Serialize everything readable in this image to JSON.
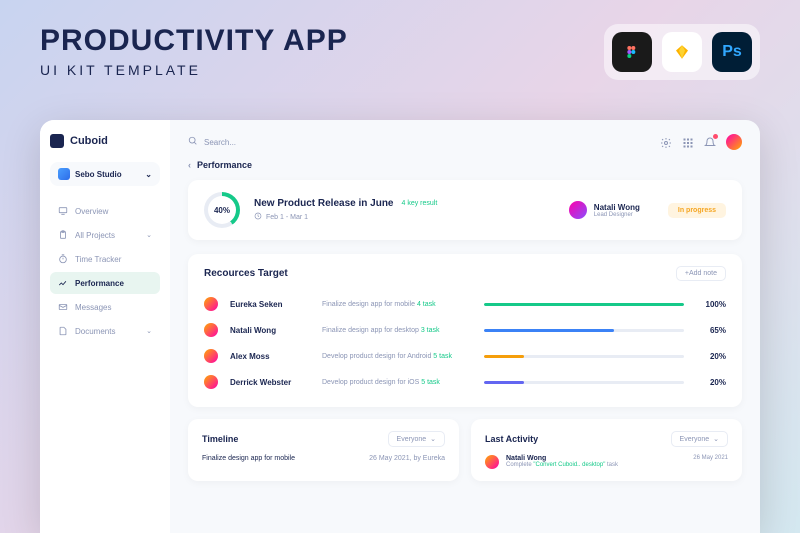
{
  "hero": {
    "title": "PRODUCTIVITY APP",
    "subtitle": "UI KIT TEMPLATE"
  },
  "brand": "Cuboid",
  "workspace": "Sebo Studio",
  "search_placeholder": "Search...",
  "nav": [
    {
      "label": "Overview",
      "icon": "monitor",
      "chev": false
    },
    {
      "label": "All Projects",
      "icon": "clipboard",
      "chev": true
    },
    {
      "label": "Time Tracker",
      "icon": "timer",
      "chev": false
    },
    {
      "label": "Performance",
      "icon": "chart",
      "chev": false,
      "active": true
    },
    {
      "label": "Messages",
      "icon": "mail",
      "chev": false
    },
    {
      "label": "Documents",
      "icon": "file",
      "chev": true
    }
  ],
  "crumb": "Performance",
  "perf": {
    "pct": "40%",
    "title": "New Product Release in June",
    "sub": "4 key result",
    "date": "Feb 1 - Mar 1",
    "user_name": "Natali Wong",
    "user_role": "Lead Designer",
    "status": "In progress"
  },
  "resources": {
    "title": "Recources Target",
    "add": "+Add note",
    "rows": [
      {
        "name": "Eureka Seken",
        "task": "Finalize design app for mobile",
        "count": "4 task",
        "pct": 100,
        "color": "#15c989"
      },
      {
        "name": "Natali Wong",
        "task": "Finalize design app for desktop",
        "count": "3 task",
        "pct": 65,
        "color": "#3b82f6"
      },
      {
        "name": "Alex Moss",
        "task": "Develop product design for Android",
        "count": "5 task",
        "pct": 20,
        "color": "#f59e0b"
      },
      {
        "name": "Derrick Webster",
        "task": "Develop product design for iOS",
        "count": "5 task",
        "pct": 20,
        "color": "#6366f1"
      }
    ]
  },
  "timeline": {
    "title": "Timeline",
    "filter": "Everyone",
    "task": "Finalize design app for mobile",
    "meta": "26 May 2021, by Eureka"
  },
  "activity": {
    "title": "Last Activity",
    "filter": "Everyone",
    "name": "Natali Wong",
    "desc_pre": "Complete ",
    "desc_hl": "\"Convert Cuboid.. desktop\"",
    "desc_post": " task",
    "date": "26 May 2021"
  }
}
